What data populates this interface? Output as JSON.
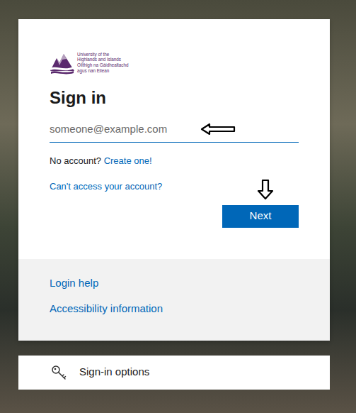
{
  "logo": {
    "lines": [
      "University of the",
      "Highlands and Islands",
      "Oilthigh na Gàidhealtachd",
      "agus nan Eilean"
    ]
  },
  "title": "Sign in",
  "email": {
    "placeholder": "someone@example.com"
  },
  "create_account": {
    "prompt": "No account?",
    "link": "Create one!"
  },
  "cant_access": "Can't access your account?",
  "next_button": "Next",
  "footer_links": [
    "Login help",
    "Accessibility information"
  ],
  "sign_in_options": "Sign-in options"
}
